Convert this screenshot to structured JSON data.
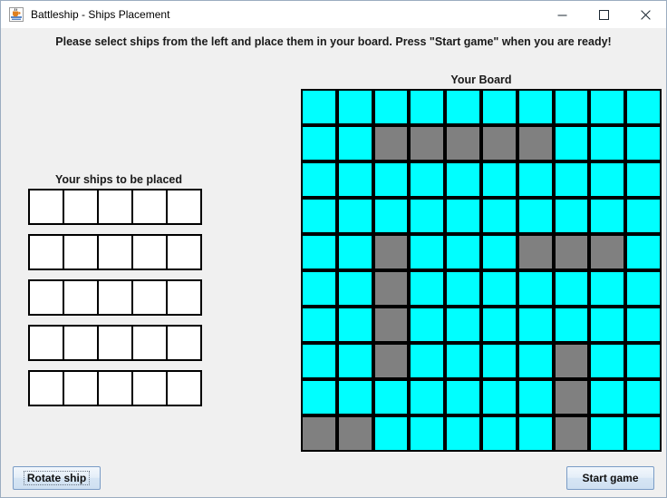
{
  "window": {
    "title": "Battleship - Ships Placement",
    "icon": "java-coffee-cup-icon",
    "minimize_label": "—",
    "maximize_label": "□",
    "close_label": "✕"
  },
  "instruction": {
    "text": "Please select ships from the left and place them in your board. Press \"Start game\" when you are ready!"
  },
  "ships_panel": {
    "title": "Your ships to be placed",
    "rows": [
      [
        "empty",
        "empty",
        "empty",
        "empty",
        "empty"
      ],
      [
        "empty",
        "empty",
        "empty",
        "empty",
        "empty"
      ],
      [
        "empty",
        "empty",
        "empty",
        "empty",
        "empty"
      ],
      [
        "empty",
        "empty",
        "empty",
        "empty",
        "empty"
      ],
      [
        "empty",
        "empty",
        "empty",
        "empty",
        "empty"
      ]
    ]
  },
  "board": {
    "title": "Your Board",
    "rows": 10,
    "cols": 10,
    "water_color": "#00ffff",
    "ship_color": "#808080",
    "grid": [
      [
        "water",
        "water",
        "water",
        "water",
        "water",
        "water",
        "water",
        "water",
        "water",
        "water"
      ],
      [
        "water",
        "water",
        "ship",
        "ship",
        "ship",
        "ship",
        "ship",
        "water",
        "water",
        "water"
      ],
      [
        "water",
        "water",
        "water",
        "water",
        "water",
        "water",
        "water",
        "water",
        "water",
        "water"
      ],
      [
        "water",
        "water",
        "water",
        "water",
        "water",
        "water",
        "water",
        "water",
        "water",
        "water"
      ],
      [
        "water",
        "water",
        "ship",
        "water",
        "water",
        "water",
        "ship",
        "ship",
        "ship",
        "water"
      ],
      [
        "water",
        "water",
        "ship",
        "water",
        "water",
        "water",
        "water",
        "water",
        "water",
        "water"
      ],
      [
        "water",
        "water",
        "ship",
        "water",
        "water",
        "water",
        "water",
        "water",
        "water",
        "water"
      ],
      [
        "water",
        "water",
        "ship",
        "water",
        "water",
        "water",
        "water",
        "ship",
        "water",
        "water"
      ],
      [
        "water",
        "water",
        "water",
        "water",
        "water",
        "water",
        "water",
        "ship",
        "water",
        "water"
      ],
      [
        "ship",
        "ship",
        "water",
        "water",
        "water",
        "water",
        "water",
        "ship",
        "water",
        "water"
      ]
    ]
  },
  "buttons": {
    "rotate_label": "Rotate ship",
    "start_label": "Start game"
  }
}
